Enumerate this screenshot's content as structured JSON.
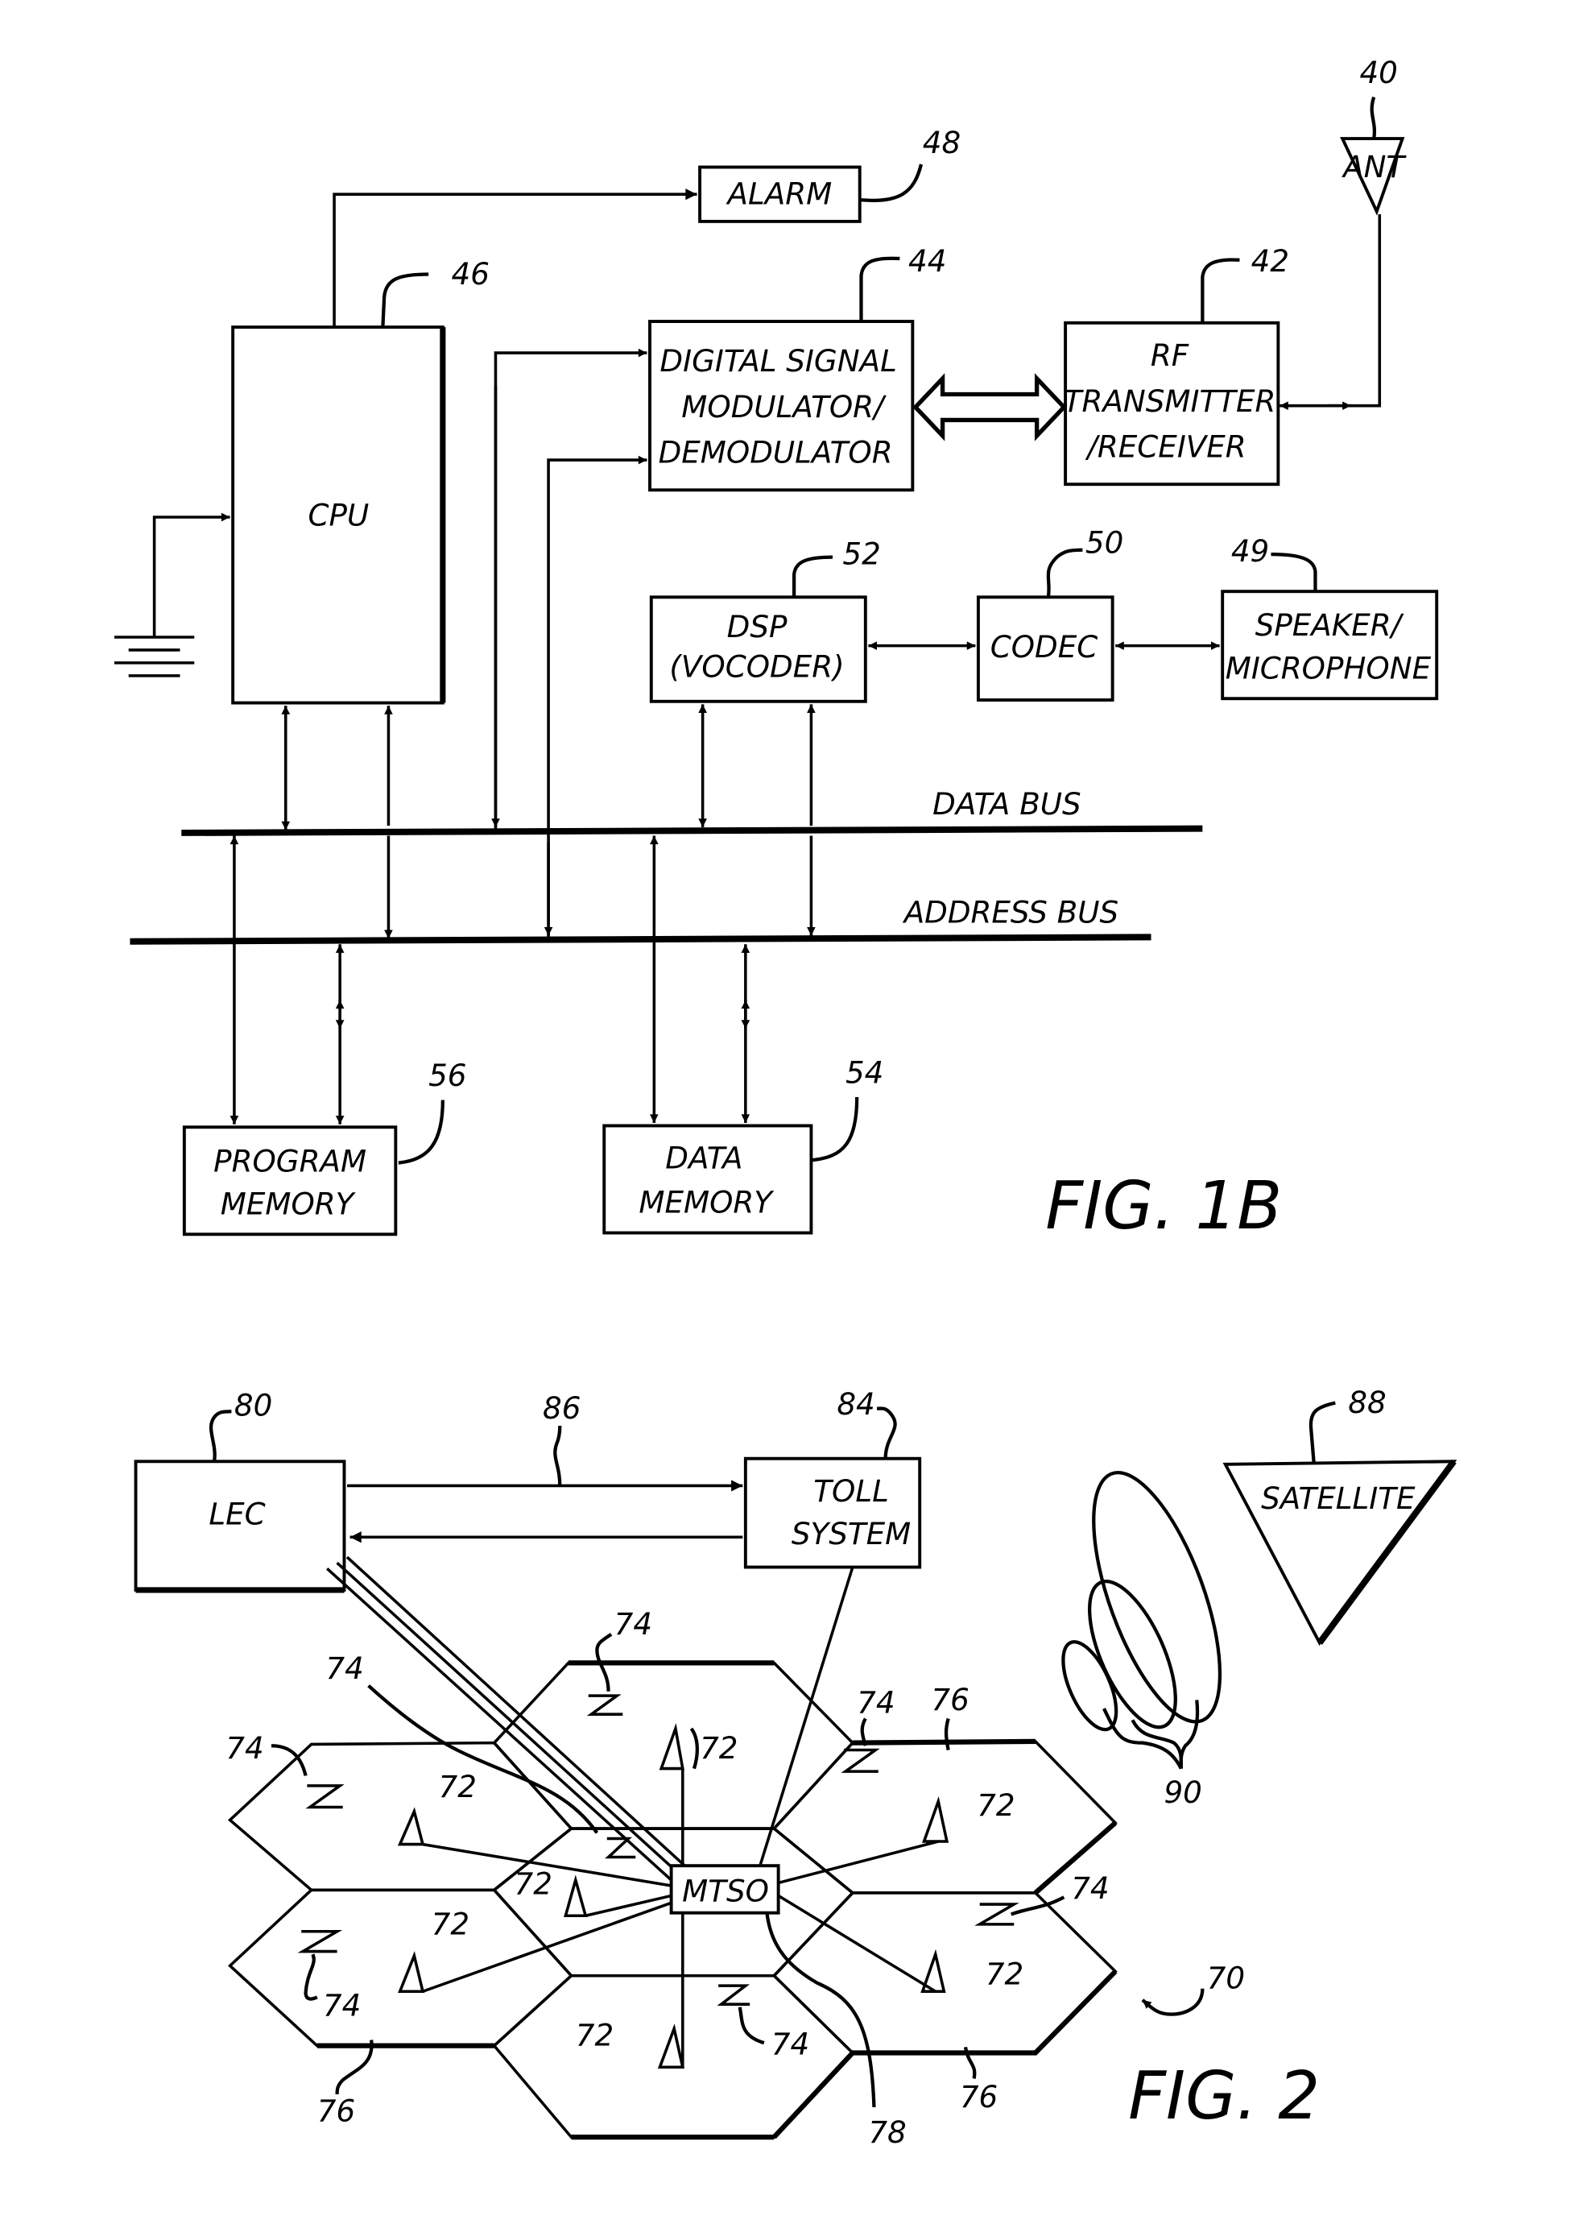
{
  "fig1b": {
    "caption": "FIG. 1B",
    "blocks": {
      "alarm": {
        "label": "ALARM",
        "ref": "48"
      },
      "antenna": {
        "label": "ANT",
        "ref": "40"
      },
      "cpu": {
        "label": "CPU",
        "ref": "46"
      },
      "modem": {
        "lines": [
          "DIGITAL SIGNAL",
          "MODULATOR/",
          "DEMODULATOR"
        ],
        "ref": "44"
      },
      "rf": {
        "lines": [
          "RF",
          "TRANSMITTER",
          "/RECEIVER"
        ],
        "ref": "42"
      },
      "dsp": {
        "lines": [
          "DSP",
          "(VOCODER)"
        ],
        "ref": "52"
      },
      "codec": {
        "label": "CODEC",
        "ref": "50"
      },
      "speaker": {
        "lines": [
          "SPEAKER/",
          "MICROPHONE"
        ],
        "ref": "49"
      },
      "program_memory": {
        "lines": [
          "PROGRAM",
          "MEMORY"
        ],
        "ref": "56"
      },
      "data_memory": {
        "lines": [
          "DATA",
          "MEMORY"
        ],
        "ref": "54"
      }
    },
    "buses": {
      "data": "DATA BUS",
      "address": "ADDRESS BUS"
    }
  },
  "fig2": {
    "caption": "FIG. 2",
    "blocks": {
      "lec": {
        "label": "LEC",
        "ref": "80"
      },
      "toll": {
        "lines": [
          "TOLL",
          "SYSTEM"
        ],
        "ref": "84"
      },
      "satellite": {
        "label": "SATELLITE",
        "ref": "88"
      },
      "mtso": {
        "label": "MTSO",
        "ref": "78"
      }
    },
    "refs": {
      "link": "86",
      "beams": "90",
      "network": "70",
      "cell_site": "72",
      "mobile": "74",
      "cell": "76"
    }
  }
}
